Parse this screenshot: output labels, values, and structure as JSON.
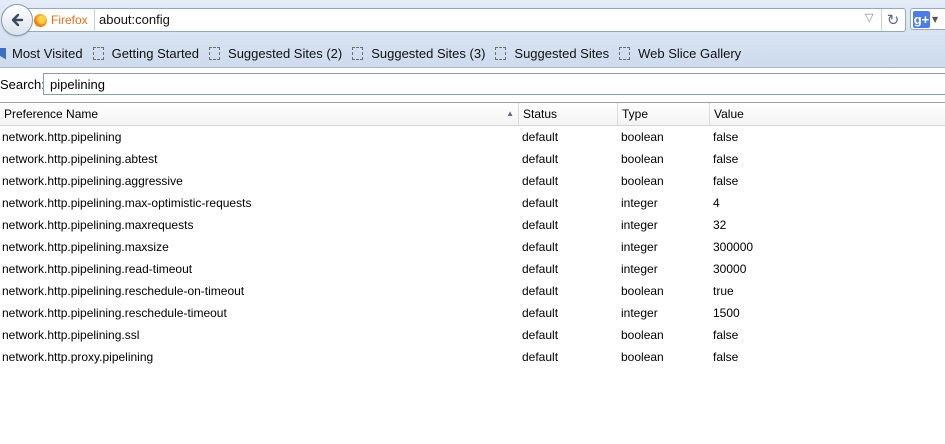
{
  "navbar": {
    "identity_label": "Firefox",
    "url": "about:config",
    "dropdown_glyph": "▽",
    "reload_glyph": "↻",
    "search_engine_logo": "g+",
    "icons": [
      "back-arrow-icon",
      "firefox-logo-icon",
      "dropdown-arrow-icon",
      "reload-icon",
      "google-logo-icon"
    ]
  },
  "bookmarks": {
    "items": [
      {
        "label": "Most Visited"
      },
      {
        "label": "Getting Started"
      },
      {
        "label": "Suggested Sites (2)"
      },
      {
        "label": "Suggested Sites (3)"
      },
      {
        "label": "Suggested Sites"
      },
      {
        "label": "Web Slice Gallery"
      }
    ]
  },
  "search": {
    "label": "Search:",
    "value": "pipelining"
  },
  "table": {
    "columns": [
      "Preference Name",
      "Status",
      "Type",
      "Value"
    ],
    "sorted_column": "Preference Name",
    "rows": [
      {
        "name": "network.http.pipelining",
        "status": "default",
        "type": "boolean",
        "value": "false"
      },
      {
        "name": "network.http.pipelining.abtest",
        "status": "default",
        "type": "boolean",
        "value": "false"
      },
      {
        "name": "network.http.pipelining.aggressive",
        "status": "default",
        "type": "boolean",
        "value": "false"
      },
      {
        "name": "network.http.pipelining.max-optimistic-requests",
        "status": "default",
        "type": "integer",
        "value": "4"
      },
      {
        "name": "network.http.pipelining.maxrequests",
        "status": "default",
        "type": "integer",
        "value": "32"
      },
      {
        "name": "network.http.pipelining.maxsize",
        "status": "default",
        "type": "integer",
        "value": "300000"
      },
      {
        "name": "network.http.pipelining.read-timeout",
        "status": "default",
        "type": "integer",
        "value": "30000"
      },
      {
        "name": "network.http.pipelining.reschedule-on-timeout",
        "status": "default",
        "type": "boolean",
        "value": "true"
      },
      {
        "name": "network.http.pipelining.reschedule-timeout",
        "status": "default",
        "type": "integer",
        "value": "1500"
      },
      {
        "name": "network.http.pipelining.ssl",
        "status": "default",
        "type": "boolean",
        "value": "false"
      },
      {
        "name": "network.http.proxy.pipelining",
        "status": "default",
        "type": "boolean",
        "value": "false"
      }
    ]
  }
}
